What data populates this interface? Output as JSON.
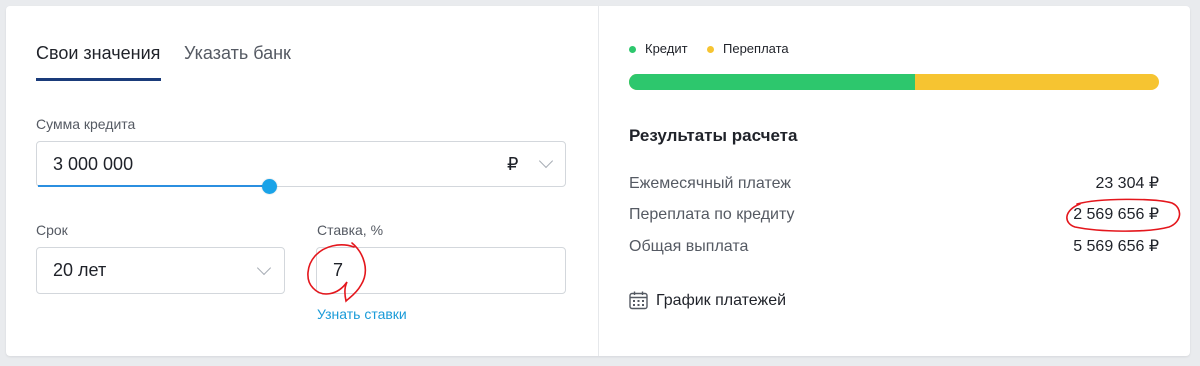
{
  "tabs": {
    "own_values": "Свои значения",
    "choose_bank": "Указать банк"
  },
  "loan_amount": {
    "label": "Сумма кредита",
    "value": "3 000 000",
    "currency": "₽",
    "slider_level": 0.44
  },
  "term": {
    "label": "Срок",
    "value": "20 лет"
  },
  "rate": {
    "label": "Ставка, %",
    "value": "7",
    "link": "Узнать ставки"
  },
  "legend": {
    "credit": "Кредит",
    "overpayment": "Переплата",
    "credit_color": "#2dc76d",
    "overpayment_color": "#f6c431"
  },
  "bar": {
    "credit_share": 0.539
  },
  "results": {
    "title": "Результаты расчета",
    "rows": [
      {
        "label": "Ежемесячный платеж",
        "value": "23 304 ₽"
      },
      {
        "label": "Переплата по кредиту",
        "value": "2 569 656 ₽"
      },
      {
        "label": "Общая выплата",
        "value": "5 569 656 ₽"
      }
    ],
    "schedule_link": "График платежей"
  },
  "annotation_color": "#e4161c",
  "icons": {
    "currency": "ruble-icon",
    "dropdown": "chevron-down-icon",
    "schedule": "calendar-icon"
  }
}
